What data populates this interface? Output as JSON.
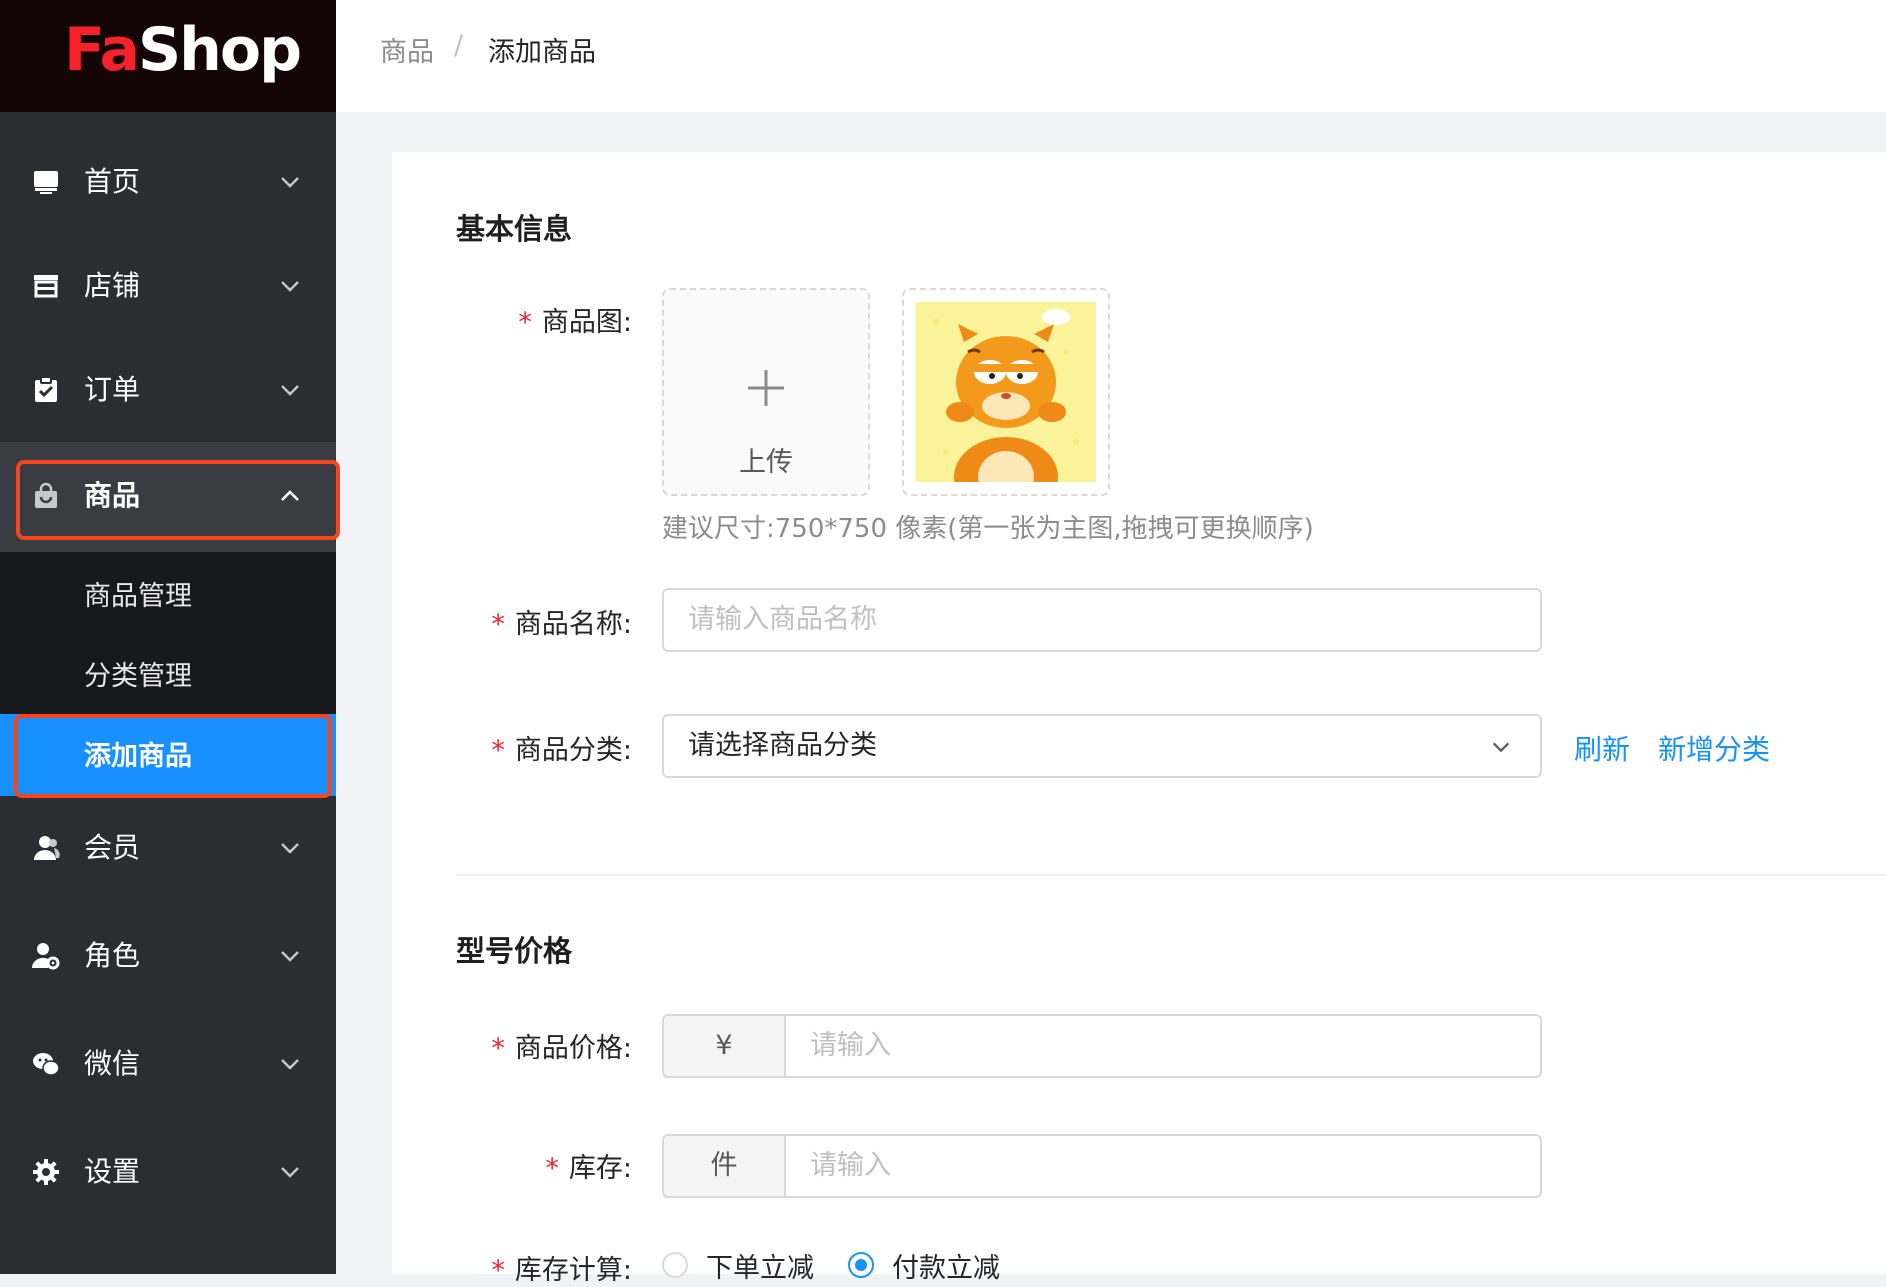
{
  "logo": {
    "part1": "Fa",
    "part2": "Shop"
  },
  "breadcrumb": {
    "parent": "商品",
    "separator": "/",
    "current": "添加商品"
  },
  "sidebar": {
    "items": [
      {
        "label": "首页",
        "icon": "desktop-icon"
      },
      {
        "label": "店铺",
        "icon": "shop-icon"
      },
      {
        "label": "订单",
        "icon": "clipboard-check-icon"
      },
      {
        "label": "商品",
        "icon": "shopping-bag-icon",
        "expanded": true
      },
      {
        "label": "会员",
        "icon": "users-icon"
      },
      {
        "label": "角色",
        "icon": "user-gear-icon"
      },
      {
        "label": "微信",
        "icon": "wechat-icon"
      },
      {
        "label": "设置",
        "icon": "gear-icon"
      }
    ],
    "goods_submenu": [
      {
        "label": "商品管理"
      },
      {
        "label": "分类管理"
      },
      {
        "label": "添加商品",
        "active": true
      }
    ]
  },
  "form": {
    "basic_section_title": "基本信息",
    "image_label": "商品图:",
    "upload_label": "上传",
    "image_hint": "建议尺寸:750*750 像素(第一张为主图,拖拽可更换顺序)",
    "name_label": "商品名称:",
    "name_placeholder": "请输入商品名称",
    "category_label": "商品分类:",
    "category_placeholder": "请选择商品分类",
    "refresh_link": "刷新",
    "add_category_link": "新增分类",
    "price_section_title": "型号价格",
    "price_label": "商品价格:",
    "price_prefix": "¥",
    "price_placeholder": "请输入",
    "stock_label": "库存:",
    "stock_prefix": "件",
    "stock_placeholder": "请输入",
    "stock_calc_label": "库存计算:",
    "stock_calc_options": [
      "下单立减",
      "付款立减"
    ],
    "stock_calc_selected": "付款立减"
  },
  "colors": {
    "accent": "#1890ff",
    "highlight": "#f5461e",
    "sidebar": "#2b2d33",
    "required": "#f5222d"
  }
}
